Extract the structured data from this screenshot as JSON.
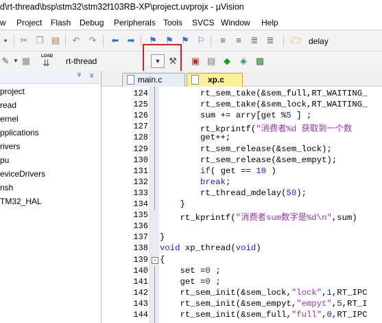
{
  "window": {
    "title": "d\\rt-thread\\bsp\\stm32\\stm32f103RB-XP\\project.uvprojx - µVision"
  },
  "menu": [
    "w",
    "Project",
    "Flash",
    "Debug",
    "Peripherals",
    "Tools",
    "SVCS",
    "Window",
    "Help"
  ],
  "toolbar1": {
    "target_label": "delay"
  },
  "toolbar2": {
    "target_select": "rt-thread",
    "load_label": "LOAD"
  },
  "project_panel": {
    "pin_glyph": "ᵠ",
    "close_glyph": "x",
    "items": [
      "project",
      "read",
      "ernel",
      "pplications",
      "rivers",
      "pu",
      "eviceDrivers",
      "nsh",
      "TM32_HAL"
    ]
  },
  "tabs": [
    {
      "label": "main.c"
    },
    {
      "label": "xp.c"
    }
  ],
  "editor": {
    "lines": [
      {
        "n": "124",
        "text": "        rt_sem_take(&sem_full,RT_WAITING_"
      },
      {
        "n": "125",
        "text": "        rt_sem_take(&sem_lock,RT_WAITING_"
      },
      {
        "n": "126",
        "text": "        sum += arry[get %5 ] ;"
      },
      {
        "n": "127",
        "text": "        rt_kprintf(\"消费者%d 获取到一个数"
      },
      {
        "n": "128",
        "text": "        get++;"
      },
      {
        "n": "129",
        "text": "        rt_sem_release(&sem_lock);"
      },
      {
        "n": "130",
        "text": "        rt_sem_release(&sem_empyt);"
      },
      {
        "n": "131",
        "text": "        if( get == 10 )"
      },
      {
        "n": "132",
        "text": "        break;"
      },
      {
        "n": "133",
        "text": "        rt_thread_mdelay(50);"
      },
      {
        "n": "134",
        "text": "    }"
      },
      {
        "n": "135",
        "text": "    rt_kprintf(\"消费者sum数字是%d\\n\",sum)"
      },
      {
        "n": "136",
        "text": ""
      },
      {
        "n": "137",
        "text": "}"
      },
      {
        "n": "138",
        "text": "void xp_thread(void)"
      },
      {
        "n": "139",
        "text": "{"
      },
      {
        "n": "140",
        "text": "    set =0 ;"
      },
      {
        "n": "141",
        "text": "    get =0 ;"
      },
      {
        "n": "142",
        "text": "    rt_sem_init(&sem_lock,\"lock\",1,RT_IPC"
      },
      {
        "n": "143",
        "text": "    rt_sem_init(&sem_empyt,\"empyt\",5,RT_I"
      },
      {
        "n": "144",
        "text": "    rt_sem_init(&sem_full,\"full\",0,RT_IPC"
      }
    ]
  },
  "colors": {
    "highlight_box": "#e21a1a",
    "keyword": "#1a1ae0",
    "string": "#9b2fb0"
  }
}
